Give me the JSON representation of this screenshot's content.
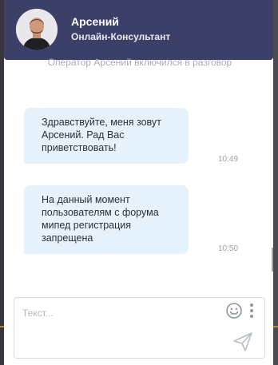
{
  "header": {
    "name": "Арсений",
    "role": "Онлайн-Консультант",
    "avatar_icon": "operator-avatar"
  },
  "chat": {
    "system_message": "Оператор Арсений включился в разговор",
    "messages": [
      {
        "text": "Здравствуйте, меня зовут Арсений. Рад Вас приветствовать!",
        "time": "10:49"
      },
      {
        "text": "На данный момент пользователям с форума мипед регистрация запрещена",
        "time": "10:50"
      }
    ]
  },
  "composer": {
    "placeholder": "Текст...",
    "emoji_icon": "smiley-icon",
    "more_icon": "more-vertical-icon",
    "send_icon": "send-icon"
  },
  "colors": {
    "header_bg": "#3c4068",
    "bubble_bg": "#e5f1fb",
    "accent_gold": "#b58a28"
  }
}
